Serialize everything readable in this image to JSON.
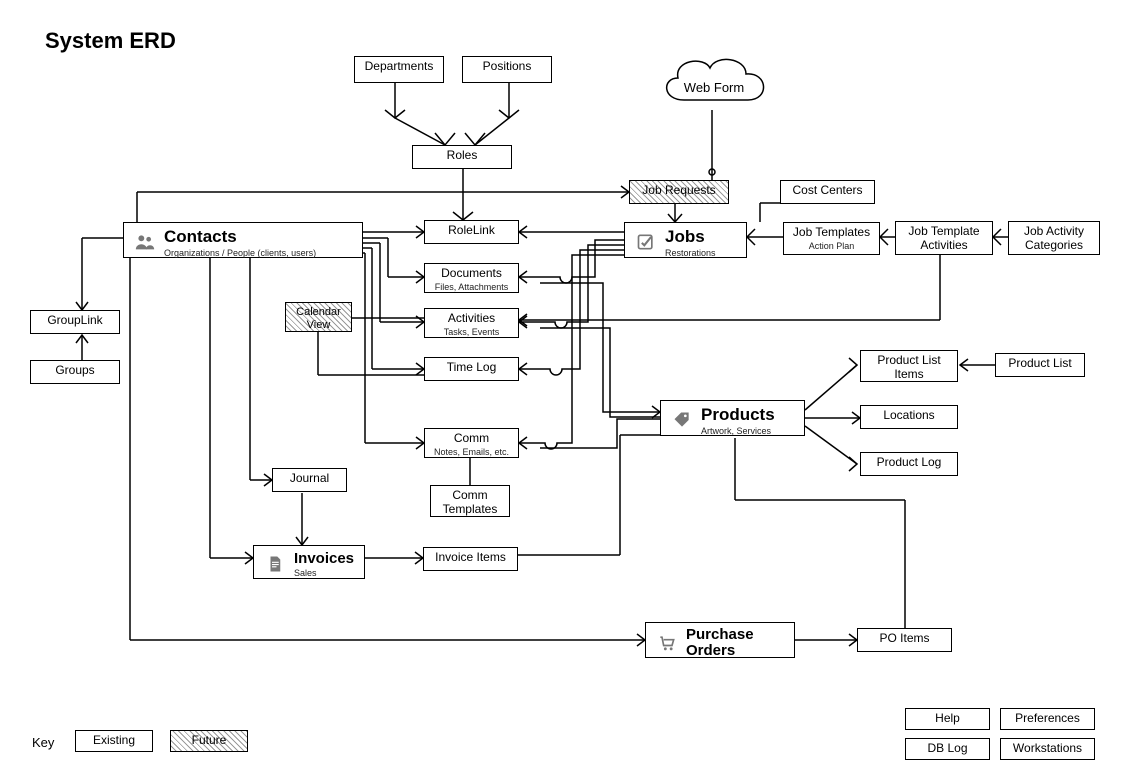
{
  "title": "System ERD",
  "entities": {
    "departments": "Departments",
    "positions": "Positions",
    "webform": "Web Form",
    "roles": "Roles",
    "job_requests": "Job Requests",
    "cost_centers": "Cost Centers",
    "contacts": {
      "title": "Contacts",
      "subtitle": "Organizations / People (clients, users)"
    },
    "rolelink": "RoleLink",
    "jobs": {
      "title": "Jobs",
      "subtitle": "Restorations"
    },
    "job_templates": {
      "title": "Job Templates",
      "subtitle": "Action Plan"
    },
    "job_template_activities": "Job Template Activities",
    "job_activity_categories": "Job Activity Categories",
    "documents": {
      "title": "Documents",
      "subtitle": "Files, Attachments"
    },
    "calendar_view": "Calendar View",
    "activities": {
      "title": "Activities",
      "subtitle": "Tasks, Events"
    },
    "time_log": "Time Log",
    "grouplink": "GroupLink",
    "groups": "Groups",
    "products": {
      "title": "Products",
      "subtitle": "Artwork, Services"
    },
    "product_list_items": "Product List Items",
    "product_list": "Product List",
    "locations": "Locations",
    "product_log": "Product Log",
    "comm": {
      "title": "Comm",
      "subtitle": "Notes, Emails, etc."
    },
    "comm_templates": "Comm Templates",
    "journal": "Journal",
    "invoices": {
      "title": "Invoices",
      "subtitle": "Sales"
    },
    "invoice_items": "Invoice Items",
    "purchase_orders": "Purchase Orders",
    "po_items": "PO Items",
    "help": "Help",
    "preferences": "Preferences",
    "db_log": "DB Log",
    "workstations": "Workstations"
  },
  "key": {
    "label": "Key",
    "existing": "Existing",
    "future": "Future"
  }
}
